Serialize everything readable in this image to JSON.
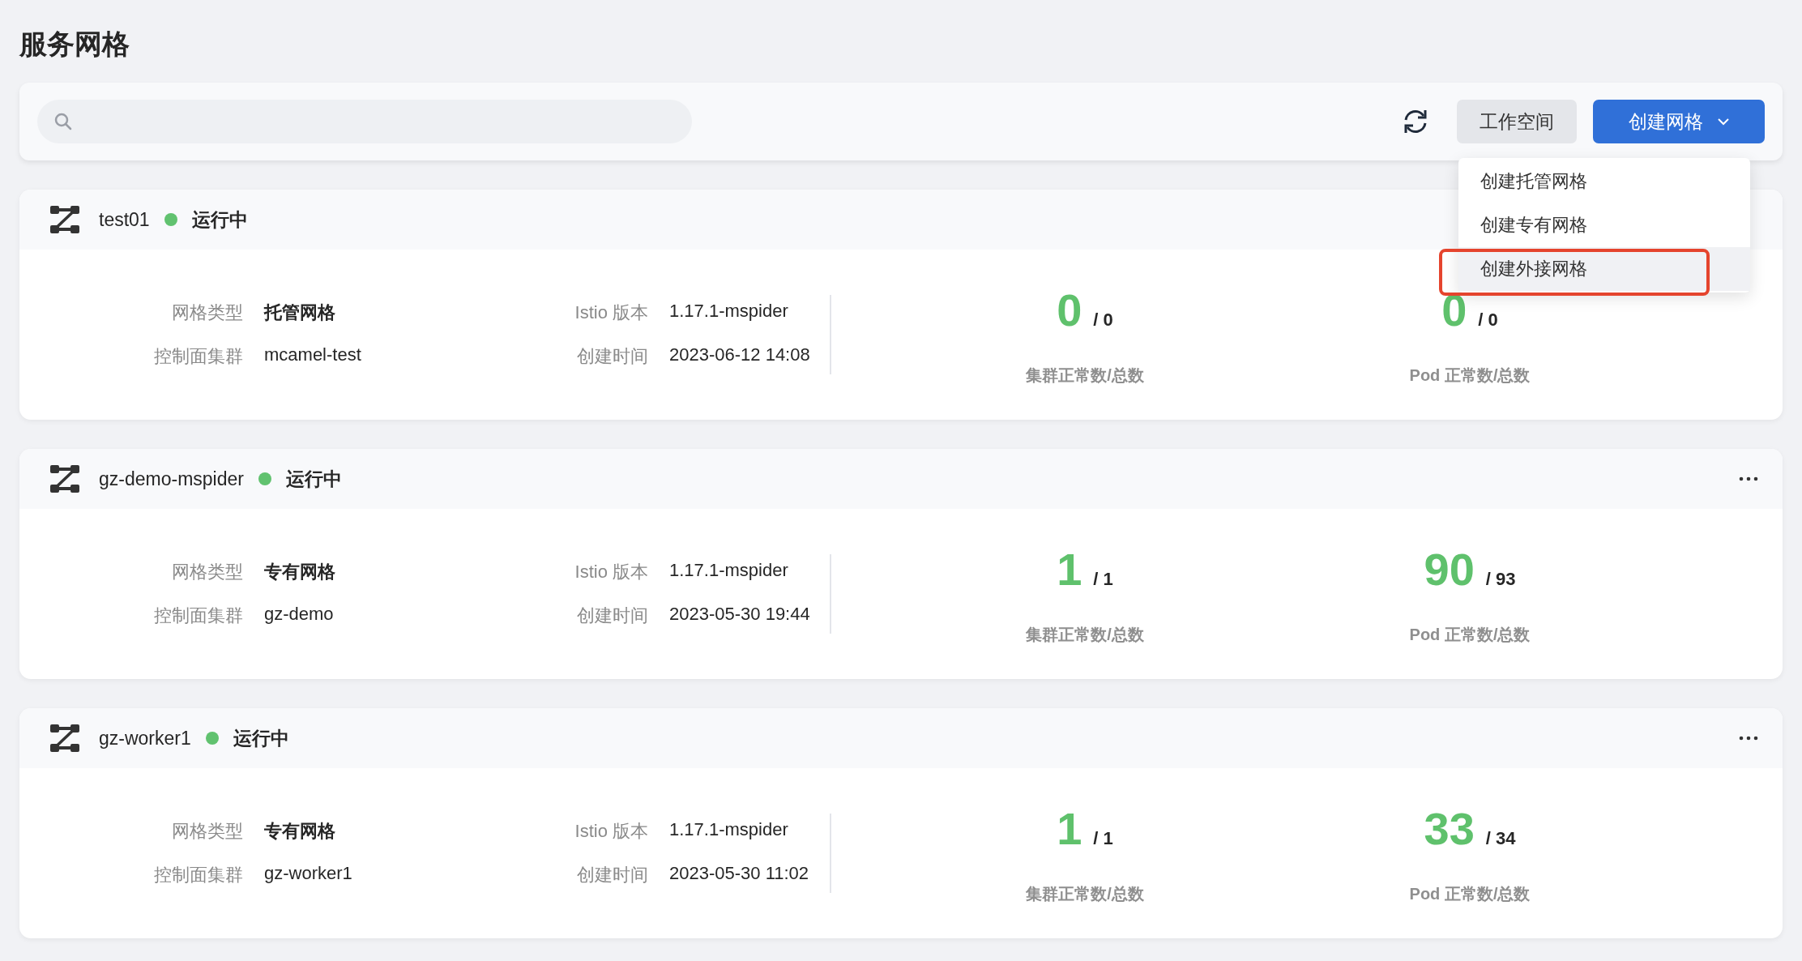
{
  "page_title": "服务网格",
  "toolbar": {
    "workspace_button": "工作空间",
    "create_button": "创建网格",
    "create_menu": [
      {
        "label": "创建托管网格",
        "selected": false,
        "highlighted": false
      },
      {
        "label": "创建专有网格",
        "selected": false,
        "highlighted": false
      },
      {
        "label": "创建外接网格",
        "selected": true,
        "highlighted": true
      }
    ]
  },
  "meshes": [
    {
      "name": "test01",
      "status": "运行中",
      "color": "#61c26f",
      "more_button": false,
      "fields": [
        {
          "label": "网格类型",
          "value": "托管网格",
          "bold": true
        },
        {
          "label": "Istio 版本",
          "value": "1.17.1-mspider",
          "bold": false
        },
        {
          "label": "控制面集群",
          "value": "mcamel-test",
          "bold": false
        },
        {
          "label": "创建时间",
          "value": "2023-06-12 14:08",
          "bold": false
        }
      ],
      "stats": [
        {
          "healthy": "0",
          "total": "/ 0",
          "label": "集群正常数/总数"
        },
        {
          "healthy": "0",
          "total": "/ 0",
          "label": "Pod 正常数/总数"
        }
      ]
    },
    {
      "name": "gz-demo-mspider",
      "status": "运行中",
      "color": "#61c26f",
      "more_button": true,
      "fields": [
        {
          "label": "网格类型",
          "value": "专有网格",
          "bold": true
        },
        {
          "label": "Istio 版本",
          "value": "1.17.1-mspider",
          "bold": false
        },
        {
          "label": "控制面集群",
          "value": "gz-demo",
          "bold": false
        },
        {
          "label": "创建时间",
          "value": "2023-05-30 19:44",
          "bold": false
        }
      ],
      "stats": [
        {
          "healthy": "1",
          "total": "/ 1",
          "label": "集群正常数/总数"
        },
        {
          "healthy": "90",
          "total": "/ 93",
          "label": "Pod 正常数/总数"
        }
      ]
    },
    {
      "name": "gz-worker1",
      "status": "运行中",
      "color": "#61c26f",
      "more_button": true,
      "fields": [
        {
          "label": "网格类型",
          "value": "专有网格",
          "bold": true
        },
        {
          "label": "Istio 版本",
          "value": "1.17.1-mspider",
          "bold": false
        },
        {
          "label": "控制面集群",
          "value": "gz-worker1",
          "bold": false
        },
        {
          "label": "创建时间",
          "value": "2023-05-30 11:02",
          "bold": false
        }
      ],
      "stats": [
        {
          "healthy": "1",
          "total": "/ 1",
          "label": "集群正常数/总数"
        },
        {
          "healthy": "33",
          "total": "/ 34",
          "label": "Pod 正常数/总数"
        }
      ]
    }
  ]
}
